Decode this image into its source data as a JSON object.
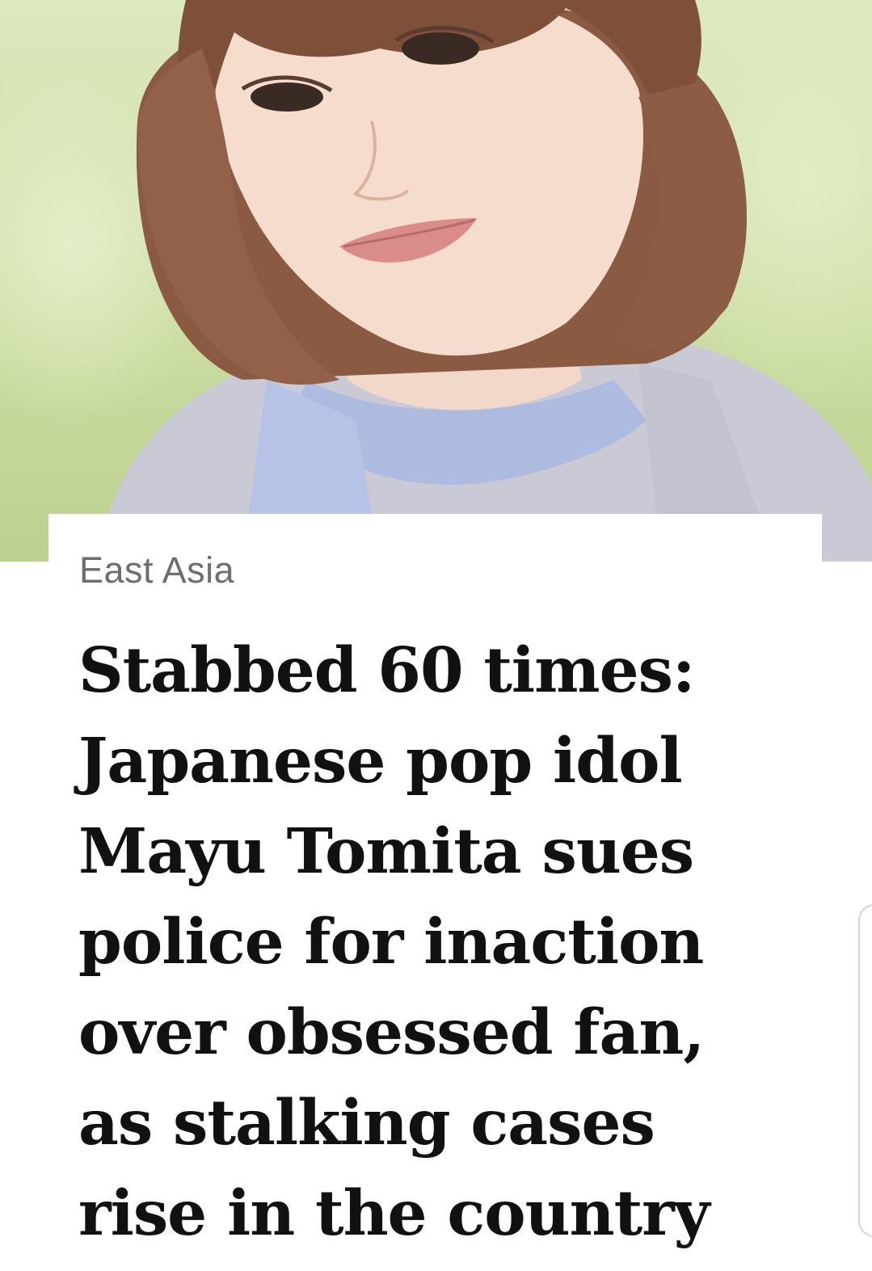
{
  "article": {
    "hero_image": "portrait-photo",
    "category": "East Asia",
    "headline": "Stabbed 60 times: Japanese pop idol Mayu Tomita sues police for inaction over obsessed fan, as stalking cases rise in the country"
  },
  "colors": {
    "background": "#ffffff",
    "category_text": "#6e6e6e",
    "headline_text": "#111111"
  }
}
